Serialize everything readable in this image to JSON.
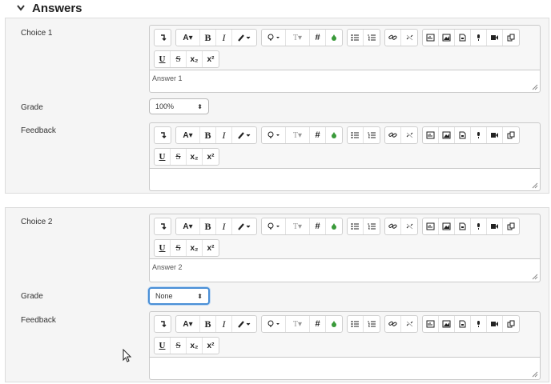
{
  "section": {
    "title": "Answers",
    "chevron_icon": "chevron-down-icon"
  },
  "toolbar": {
    "row1": [
      [
        "collapse-icon"
      ],
      [
        "font-color-icon",
        "bold-icon",
        "italic-icon",
        "highlight-icon"
      ],
      [
        "bulb-icon",
        "styles-icon",
        "hash-icon",
        "recycle-icon"
      ],
      [
        "bullet-list-icon",
        "numbered-list-icon"
      ],
      [
        "link-icon",
        "unlink-icon"
      ],
      [
        "media-manager-icon",
        "image-icon",
        "file-icon",
        "mic-icon",
        "video-icon",
        "copy-icon"
      ]
    ],
    "row2": [
      [
        "underline-icon",
        "strikethrough-icon",
        "subscript-icon",
        "superscript-icon"
      ]
    ]
  },
  "labels": {
    "font_a": "A▾",
    "bold": "B",
    "italic": "I",
    "styles": "T▾",
    "hash": "#",
    "underline": "U",
    "strike": "S",
    "sub": "x₂",
    "sup": "x²"
  },
  "choices": [
    {
      "label": "Choice 1",
      "answer": "Answer 1",
      "grade_label": "Grade",
      "grade_value": "100%",
      "feedback_label": "Feedback",
      "feedback_value": ""
    },
    {
      "label": "Choice 2",
      "answer": "Answer 2",
      "grade_label": "Grade",
      "grade_value": "None",
      "feedback_label": "Feedback",
      "feedback_value": ""
    }
  ],
  "colors": {
    "focus": "#4a8fd6",
    "recycle": "#3a9a3a",
    "panel_bg": "#f5f5f5"
  }
}
